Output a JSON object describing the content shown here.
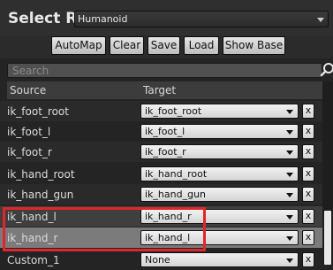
{
  "header": {
    "title": "Select Rig",
    "rig_value": "Humanoid"
  },
  "toolbar": {
    "automap": "AutoMap",
    "clear": "Clear",
    "save": "Save",
    "load": "Load",
    "show_base": "Show Base"
  },
  "search": {
    "placeholder": "Search"
  },
  "columns": {
    "source": "Source",
    "target": "Target"
  },
  "rows": [
    {
      "source": "ik_foot_root",
      "target": "ik_foot_root",
      "clear": "x"
    },
    {
      "source": "ik_foot_l",
      "target": "ik_foot_l",
      "clear": "x"
    },
    {
      "source": "ik_foot_r",
      "target": "ik_foot_r",
      "clear": "x"
    },
    {
      "source": "ik_hand_root",
      "target": "ik_hand_root",
      "clear": "x"
    },
    {
      "source": "ik_hand_gun",
      "target": "ik_hand_gun",
      "clear": "x"
    },
    {
      "source": "ik_hand_l",
      "target": "ik_hand_r",
      "clear": "x"
    },
    {
      "source": "ik_hand_r",
      "target": "ik_hand_l",
      "clear": "x"
    },
    {
      "source": "Custom_1",
      "target": "None",
      "clear": "x"
    }
  ],
  "annotation": {
    "highlight_color": "#e0262b"
  }
}
